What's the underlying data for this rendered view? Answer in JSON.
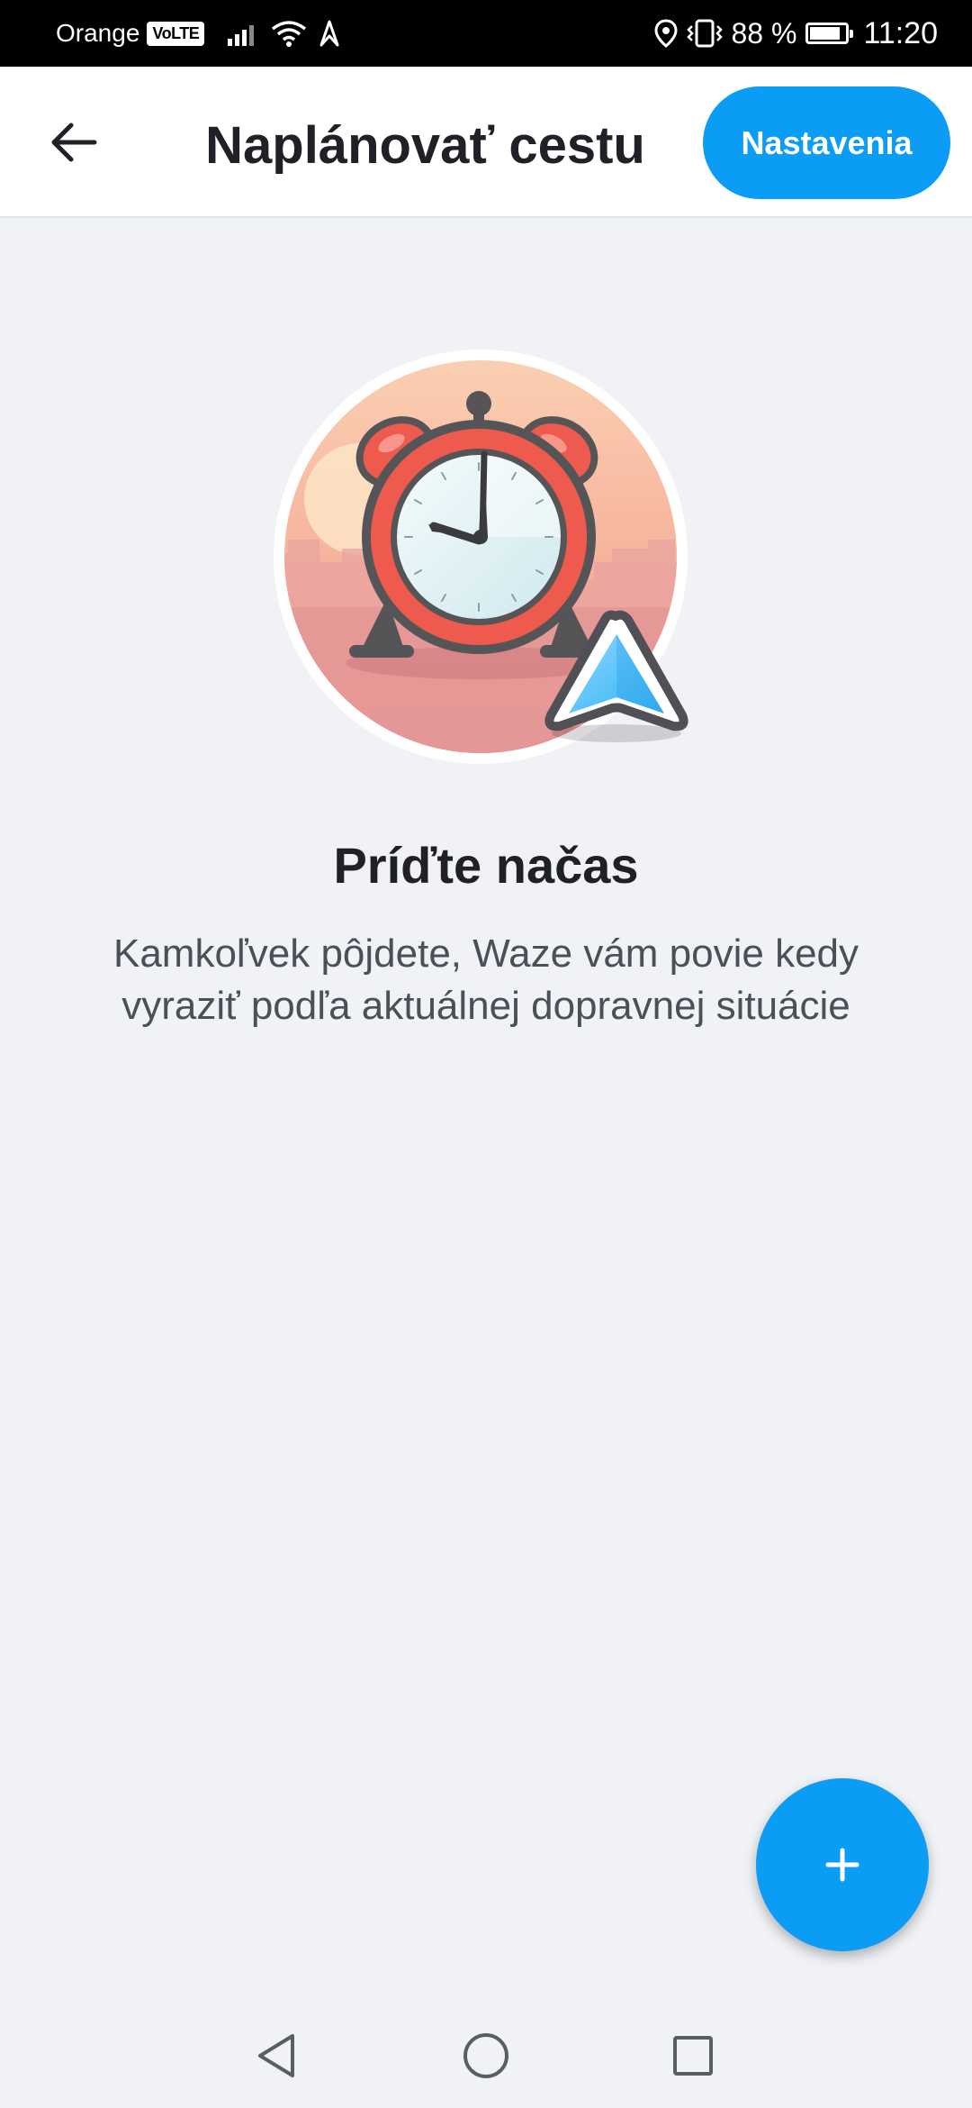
{
  "status_bar": {
    "carrier": "Orange",
    "volte": "VoLTE",
    "battery_percent": "88 %",
    "battery_level": 0.88,
    "time": "11:20",
    "icons": [
      "signal-icon",
      "wifi-icon",
      "data-icon",
      "location-icon",
      "vibrate-icon",
      "battery-icon"
    ]
  },
  "header": {
    "back_icon": "arrow-left-icon",
    "title": "Naplánovať cestu",
    "settings_label": "Nastavenia"
  },
  "illustration": {
    "icon": "alarm-clock-icon",
    "badge_icon": "navigation-arrow-icon"
  },
  "content": {
    "headline": "Príďte načas",
    "subtext": "Kamkoľvek pôjdete, Waze vám povie kedy vyraziť podľa aktuálnej dopravnej situácie"
  },
  "fab": {
    "icon": "plus-icon"
  },
  "nav_bar": {
    "icons": [
      "back-triangle-icon",
      "home-circle-icon",
      "recents-square-icon"
    ]
  },
  "colors": {
    "accent": "#0b9cf5",
    "background": "#f0f2f6",
    "text_primary": "#1f2126",
    "text_secondary": "#4b4f58"
  }
}
